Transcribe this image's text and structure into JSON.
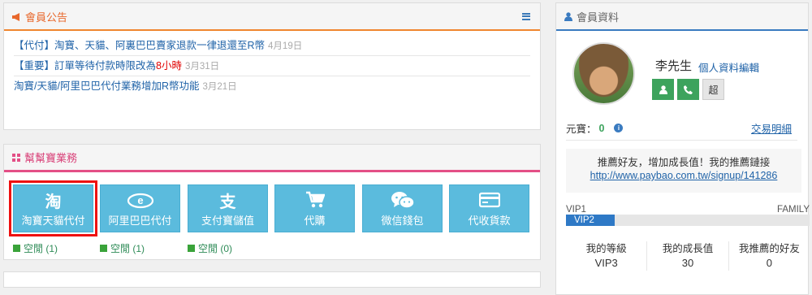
{
  "announcements": {
    "title": "會員公告",
    "items": [
      {
        "text": "【代付】淘寶、天貓、阿裏巴巴賣家退款一律退還至R幣",
        "date": "4月19日"
      },
      {
        "text_before": "【重要】訂單等待付款時限改為",
        "text_red": "8小時",
        "date": "3月31日"
      },
      {
        "text": "淘寶/天貓/阿里巴巴代付業務增加R幣功能",
        "date": "3月21日"
      }
    ]
  },
  "business": {
    "title": "幫幫寶業務",
    "services": [
      {
        "glyph": "淘",
        "label": "淘寶天貓代付"
      },
      {
        "glyph": "e",
        "label": "阿里巴巴代付"
      },
      {
        "glyph": "支",
        "label": "支付寶儲值"
      },
      {
        "glyph": "cart-icon",
        "label": "代購"
      },
      {
        "glyph": "wechat-icon",
        "label": "微信錢包"
      },
      {
        "glyph": "card-icon",
        "label": "代收貨款"
      }
    ],
    "statuses": [
      "空閒 (1)",
      "空閒 (1)",
      "空閒 (0)"
    ]
  },
  "member": {
    "title": "會員資料",
    "name": "李先生",
    "edit_label": "個人資料編輯",
    "btn_super": "超",
    "ingot_label": "元寶：",
    "ingot_value": "0",
    "info_glyph": "i",
    "transactions_label": "交易明細",
    "refer_text": "推薦好友，增加成長值！我的推薦鏈接",
    "refer_url": "http://www.paybao.com.tw/signup/141286",
    "vip_left": "VIP1",
    "vip_right": "FAMILY",
    "vip_current": "VIP2",
    "vip_progress": 0.2,
    "stats": [
      {
        "label": "我的等級",
        "value": "VIP3"
      },
      {
        "label": "我的成長值",
        "value": "30"
      },
      {
        "label": "我推薦的好友",
        "value": "0"
      }
    ]
  },
  "colors": {
    "accent_orange": "#f0862f",
    "accent_pink": "#e34f86",
    "accent_blue": "#3a7bc0",
    "service_bg": "#5bbbdd",
    "green": "#3da35d"
  }
}
